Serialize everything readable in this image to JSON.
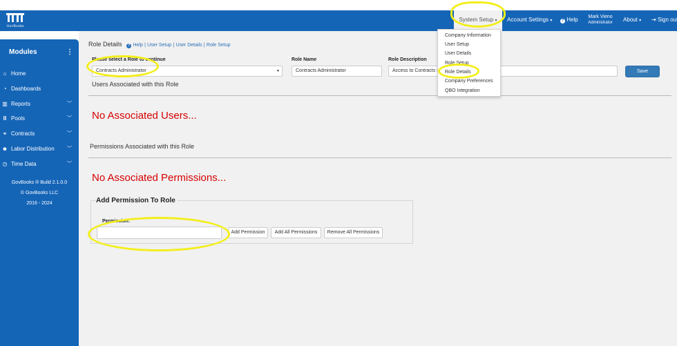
{
  "navbar": {
    "logo_text": "GovBooks",
    "system_setup": "System Setup",
    "account_settings": "Account Settings",
    "help": "Help",
    "user_name": "Mark Vieno",
    "user_role": "Administrator",
    "about": "About",
    "sign_out": "Sign out"
  },
  "sidebar": {
    "title": "Modules",
    "items": [
      {
        "label": "Home",
        "icon": "home-icon"
      },
      {
        "label": "Dashboards",
        "icon": "dashboard-icon"
      },
      {
        "label": "Reports",
        "icon": "chart-icon"
      },
      {
        "label": "Pools",
        "icon": "columns-icon"
      },
      {
        "label": "Contracts",
        "icon": "handshake-icon"
      },
      {
        "label": "Labor Distribution",
        "icon": "users-icon"
      },
      {
        "label": "Time Data",
        "icon": "clock-icon"
      }
    ],
    "footer": [
      "GovBooks ® Build 2.1.0.0",
      "© GovBooks LLC",
      "2016 - 2024"
    ]
  },
  "breadcrumb": {
    "title": "Role Details",
    "help": "Help",
    "links": [
      "User Setup",
      "User Details",
      "Role Setup"
    ]
  },
  "form": {
    "role_select_label": "Please select a Role to continue",
    "role_select_value": "Contracts Administrator",
    "role_name_label": "Role Name",
    "role_name_value": "Contracts Administrator",
    "role_desc_label": "Role Description",
    "role_desc_value": "Access to Contracts M",
    "save": "Save"
  },
  "users_section": {
    "title": "Users Associated with this Role",
    "empty": "No Associated Users..."
  },
  "permissions_section": {
    "title": "Permissions Associated with this Role",
    "empty": "No Associated Permissions..."
  },
  "add_permission": {
    "legend": "Add Permission To Role",
    "label": "Permission:",
    "value": "",
    "buttons": [
      "Add Permission",
      "Add All Permissions",
      "Remove All Permissions"
    ]
  },
  "dropdown": {
    "items": [
      "Company Information",
      "User Setup",
      "User Details",
      "Role Setup",
      "Role Details",
      "Company Preferences",
      "QBO Integration"
    ]
  },
  "colors": {
    "brand": "#1565b7",
    "error": "#d60000",
    "highlight": "#f3ee19",
    "primary_button": "#337ab7"
  }
}
